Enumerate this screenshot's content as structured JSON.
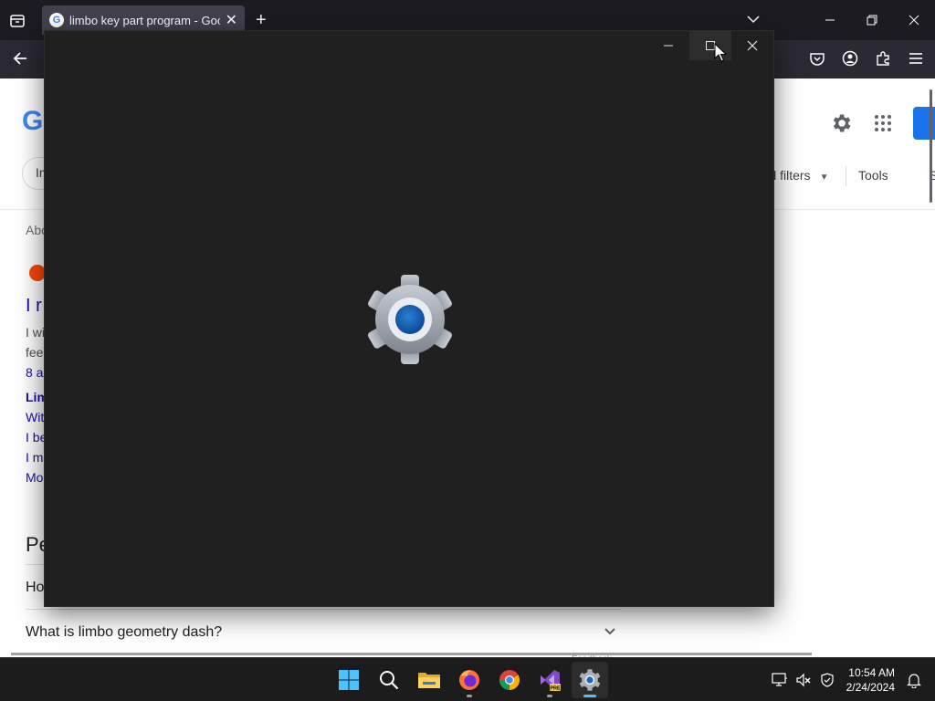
{
  "browser": {
    "tab_title": "limbo key part program - Goog",
    "new_tab_label": "+",
    "tab_close_label": "✕",
    "favicon_letter": "G"
  },
  "google": {
    "logo_letter": "G",
    "chip_partial": "Im",
    "filters_label": "ll filters",
    "tools_label": "Tools",
    "more_partial": "S",
    "about_partial": "Abo",
    "result_title_partial": "I r",
    "snippet_lines": [
      "I wi",
      "fee",
      "8 a"
    ],
    "link_lines": [
      "Lim",
      "With",
      "I be",
      "I m",
      "Mo"
    ],
    "paa_header_partial": "Pe",
    "paa_item_partial": "Ho",
    "paa_item_full": "What is limbo geometry dash?",
    "faded_text": "Feedback"
  },
  "taskbar": {
    "apps": [
      {
        "name": "start",
        "icon": "windows-start-icon"
      },
      {
        "name": "search",
        "icon": "search-icon"
      },
      {
        "name": "file-explorer",
        "icon": "folder-icon"
      },
      {
        "name": "firefox",
        "icon": "firefox-icon"
      },
      {
        "name": "chrome",
        "icon": "chrome-icon"
      },
      {
        "name": "visual-studio-preview",
        "icon": "visual-studio-icon",
        "badge": "PRE"
      },
      {
        "name": "settings",
        "icon": "gear-icon"
      }
    ],
    "time": "10:54 AM",
    "date": "2/24/2024"
  },
  "colors": {
    "accent": "#4cc2ff",
    "splash_bg": "#202020",
    "gear_blue": "#0f5fb8"
  }
}
